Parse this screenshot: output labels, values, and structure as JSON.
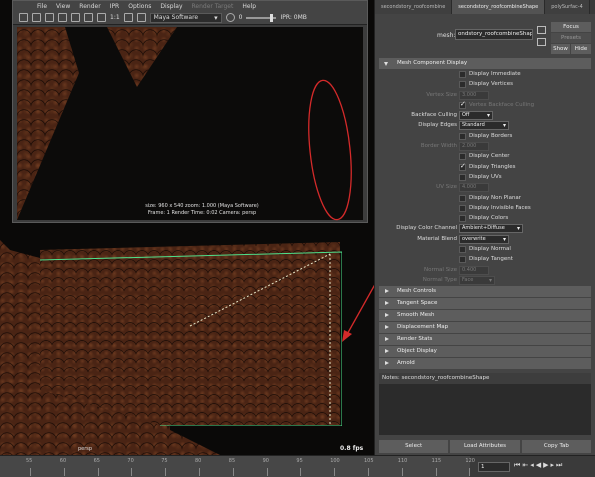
{
  "viewport": {
    "camera_label": "persp",
    "fps": "0.8 fps"
  },
  "render_view": {
    "menu": [
      "File",
      "View",
      "Render",
      "IPR",
      "Options",
      "Display",
      "Render Target",
      "Help"
    ],
    "menu_disabled": [
      "Render Target"
    ],
    "ratio": "1:1",
    "renderer": "Maya Software",
    "ipr_status": "IPR: 0MB",
    "info_line1": "size: 960 x 540  zoom: 1.000       (Maya Software)",
    "info_line2": "Frame: 1      Render Time: 0:02      Camera: persp"
  },
  "attribute_editor": {
    "tabs": [
      "secondstory_roofcombine",
      "secondstory_roofcombineShape",
      "polySurfac-4"
    ],
    "active_tab": 1,
    "mesh_label": "mesh:",
    "mesh_value": "ondstory_roofcombineShape",
    "buttons": {
      "focus": "Focus",
      "presets": "Presets",
      "show": "Show",
      "hide": "Hide"
    },
    "section_open": "Mesh Component Display",
    "rows": [
      {
        "type": "check",
        "label": "Display Immediate",
        "checked": false,
        "dim": false
      },
      {
        "type": "check",
        "label": "Display Vertices",
        "checked": false,
        "dim": false
      },
      {
        "type": "field",
        "label": "Vertex Size",
        "value": "3.000",
        "dim": true
      },
      {
        "type": "check",
        "label": "Vertex Backface Culling",
        "checked": true,
        "dim": true
      },
      {
        "type": "select",
        "label": "Backface Culling",
        "value": "Off",
        "dim": false,
        "w": 34
      },
      {
        "type": "select",
        "label": "Display Edges",
        "value": "Standard",
        "dim": false,
        "w": 50
      },
      {
        "type": "check",
        "label": "Display Borders",
        "checked": false,
        "dim": false
      },
      {
        "type": "field",
        "label": "Border Width",
        "value": "2.000",
        "dim": true
      },
      {
        "type": "check",
        "label": "Display Center",
        "checked": false,
        "dim": false
      },
      {
        "type": "check",
        "label": "Display Triangles",
        "checked": true,
        "dim": false
      },
      {
        "type": "check",
        "label": "Display UVs",
        "checked": false,
        "dim": false
      },
      {
        "type": "field",
        "label": "UV Size",
        "value": "4.000",
        "dim": true
      },
      {
        "type": "check",
        "label": "Display Non Planar",
        "checked": false,
        "dim": false
      },
      {
        "type": "check",
        "label": "Display Invisible Faces",
        "checked": false,
        "dim": false
      },
      {
        "type": "check",
        "label": "Display Colors",
        "checked": false,
        "dim": false
      },
      {
        "type": "select",
        "label": "Display Color Channel",
        "value": "Ambient+Diffuse",
        "dim": false,
        "w": 64
      },
      {
        "type": "select",
        "label": "Material Blend",
        "value": "overwrite",
        "dim": false,
        "w": 50
      },
      {
        "type": "check",
        "label": "Display Normal",
        "checked": false,
        "dim": false
      },
      {
        "type": "check",
        "label": "Display Tangent",
        "checked": false,
        "dim": false
      },
      {
        "type": "field",
        "label": "Normal Size",
        "value": "0.400",
        "dim": true
      },
      {
        "type": "select",
        "label": "Normal Type",
        "value": "Face",
        "dim": true,
        "w": 36
      }
    ],
    "sections": [
      "Mesh Controls",
      "Tangent Space",
      "Smooth Mesh",
      "Displacement Map",
      "Render Stats",
      "Object Display",
      "Arnold"
    ],
    "notes_label": "Notes: secondstory_roofcombineShape",
    "bottom_buttons": [
      "Select",
      "Load Attributes",
      "Copy Tab"
    ]
  },
  "timeline": {
    "ticks": [
      "55",
      "60",
      "65",
      "70",
      "75",
      "80",
      "85",
      "90",
      "95",
      "100",
      "105",
      "110",
      "115",
      "120"
    ],
    "current_frame": "1"
  },
  "colors": {
    "annotation_red": "#d42a2a",
    "selection_green": "#4fe28c"
  }
}
